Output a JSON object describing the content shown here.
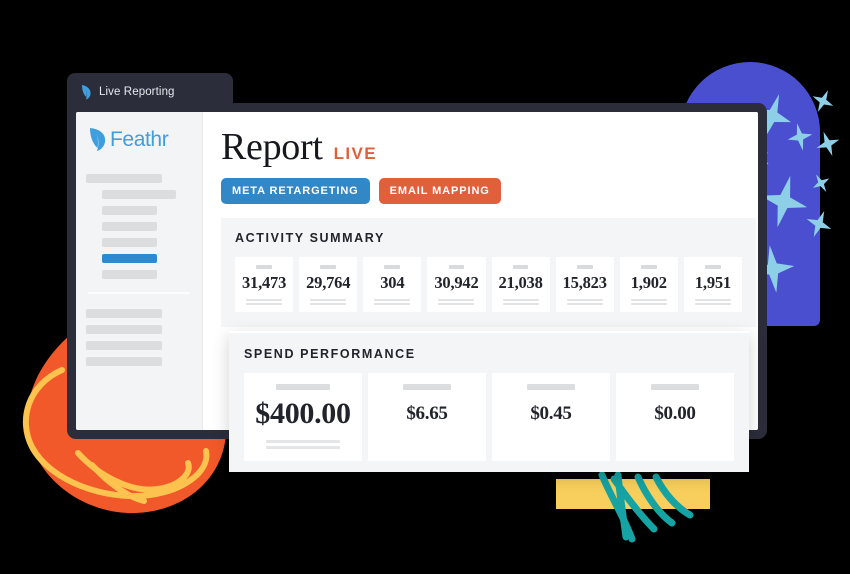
{
  "window": {
    "tab_label": "Live Reporting",
    "tab_icon": "feather-icon"
  },
  "sidebar": {
    "logo_text": "Feathr",
    "logo_icon": "feather-logo-icon",
    "nav_items": [
      {
        "name": "nav-placeholder-1",
        "width": "72%",
        "indent": false,
        "active": false
      },
      {
        "name": "nav-placeholder-2",
        "width": "70%",
        "indent": true,
        "active": false
      },
      {
        "name": "nav-placeholder-3",
        "width": "52%",
        "indent": true,
        "active": false
      },
      {
        "name": "nav-placeholder-4",
        "width": "52%",
        "indent": true,
        "active": false
      },
      {
        "name": "nav-placeholder-5",
        "width": "52%",
        "indent": true,
        "active": false
      },
      {
        "name": "nav-placeholder-6-active",
        "width": "52%",
        "indent": true,
        "active": true
      },
      {
        "name": "nav-placeholder-7",
        "width": "52%",
        "indent": true,
        "active": false
      }
    ],
    "nav_items_secondary": [
      {
        "name": "nav-secondary-1",
        "width": "72%"
      },
      {
        "name": "nav-secondary-2",
        "width": "72%"
      },
      {
        "name": "nav-secondary-3",
        "width": "72%"
      },
      {
        "name": "nav-secondary-4",
        "width": "72%"
      }
    ]
  },
  "header": {
    "title": "Report",
    "status": "LIVE",
    "pills": [
      {
        "label": "META RETARGETING",
        "color": "#3288c7"
      },
      {
        "label": "EMAIL MAPPING",
        "color": "#e0603c"
      }
    ]
  },
  "activity_summary": {
    "title": "ACTIVITY SUMMARY",
    "stats": [
      "31,473",
      "29,764",
      "304",
      "30,942",
      "21,038",
      "15,823",
      "1,902",
      "1,951"
    ]
  },
  "spend_performance": {
    "title": "SPEND PERFORMANCE",
    "cards": [
      {
        "amount": "$400.00",
        "size": "big"
      },
      {
        "amount": "$6.65",
        "size": "small"
      },
      {
        "amount": "$0.45",
        "size": "small"
      },
      {
        "amount": "$0.00",
        "size": "small"
      }
    ]
  },
  "decoration": {
    "blue_arch_color": "#4a4fd0",
    "sparkle_color": "#8ecfe8",
    "orange_blob_color": "#f1592a",
    "yellow_swirl_color": "#fcc34e",
    "yellow_rect_color": "#f8cf5c",
    "teal_scribble_color": "#16a3a3"
  }
}
